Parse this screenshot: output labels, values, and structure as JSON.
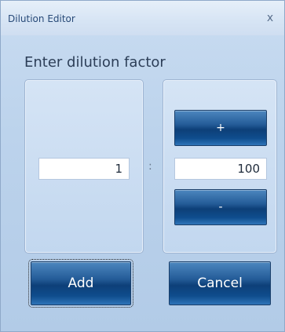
{
  "window": {
    "title": "Dilution Editor",
    "close_glyph": "x"
  },
  "prompt": "Enter dilution factor",
  "dilution": {
    "numerator": "1",
    "separator": ":",
    "denominator": "100"
  },
  "stepper": {
    "increment_label": "+",
    "decrement_label": "-"
  },
  "actions": {
    "add_label": "Add",
    "cancel_label": "Cancel"
  },
  "icons": {
    "close": "close-icon"
  },
  "colors": {
    "button_blue": "#0d3f78",
    "title_text": "#284a78",
    "panel_bg": "#c2d7ef"
  }
}
